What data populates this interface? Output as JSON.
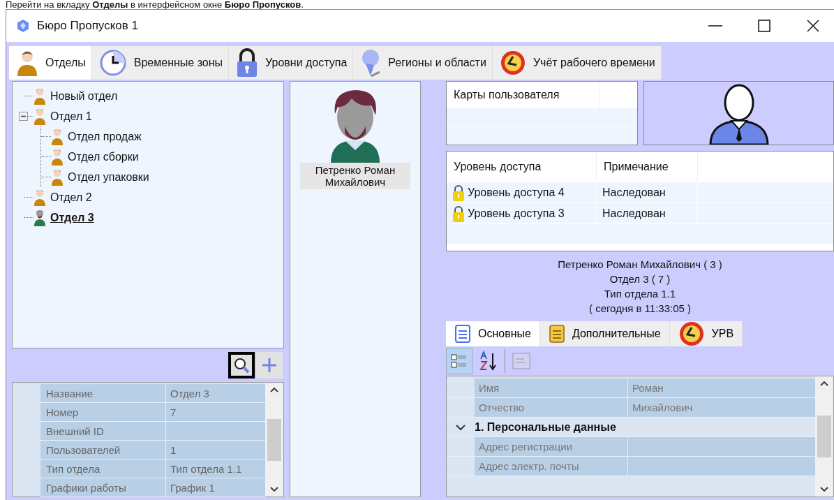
{
  "caption": "Перейти на вкладку **Отделы** в интерфейсном окне **Бюро Пропусков**.",
  "window": {
    "title": "Бюро Пропусков 1"
  },
  "tabs": [
    {
      "label": "Отделы",
      "kind": "person",
      "selected": true
    },
    {
      "label": "Временные зоны",
      "kind": "clock",
      "selected": false
    },
    {
      "label": "Уровни доступа",
      "kind": "lock",
      "selected": false
    },
    {
      "label": "Регионы и области",
      "kind": "pin",
      "selected": false
    },
    {
      "label": "Учёт рабочего времени",
      "kind": "alarm",
      "selected": false
    }
  ],
  "tree": [
    {
      "label": "Новый отдел",
      "selected": false
    },
    {
      "label": "Отдел 1",
      "selected": false,
      "expanded": true,
      "children": [
        {
          "label": "Отдел продаж",
          "selected": false
        },
        {
          "label": "Отдел сборки",
          "selected": false
        },
        {
          "label": "Отдел упаковки",
          "selected": false
        }
      ]
    },
    {
      "label": "Отдел 2",
      "selected": false
    },
    {
      "label": "Отдел 3",
      "selected": true
    }
  ],
  "tree_toolbar": {
    "search_focused": true
  },
  "department_properties": [
    {
      "name": "Название",
      "value": "Отдел 3"
    },
    {
      "name": "Номер",
      "value": "7"
    },
    {
      "name": "Внешний ID"
    },
    {
      "name": "Пользователей",
      "value": "1"
    },
    {
      "name": "Тип отдела",
      "value": "Тип отдела 1.1"
    },
    {
      "name": "Графики работы",
      "value": "График 1"
    }
  ],
  "users": [
    {
      "name": "Петренко Роман Михайлович",
      "selected": true
    }
  ],
  "cards_table": {
    "columns": [
      "Карты пользователя"
    ]
  },
  "access_table": {
    "columns": [
      "Уровень доступа",
      "Примечание"
    ],
    "rows": [
      {
        "level": "Уровень доступа 4",
        "note": "Наследован"
      },
      {
        "level": "Уровень доступа 3",
        "note": "Наследован"
      }
    ]
  },
  "info": [
    "Петренко Роман Михайлович ( 3 )",
    "Отдел 3 ( 7 )",
    "Тип отдела 1.1",
    "( сегодня в 11:33:05 )"
  ],
  "subtabs": [
    {
      "label": "Основные",
      "kind": "list",
      "selected": true
    },
    {
      "label": "Дополнительные",
      "kind": "notes",
      "selected": false
    },
    {
      "label": "УРВ",
      "kind": "alarm",
      "selected": false
    }
  ],
  "grid_toolbar": {
    "categorized_selected": true,
    "alphabetical_selected": false,
    "pages_disabled": true
  },
  "user_properties": [
    {
      "kind": "row",
      "name": "Имя",
      "value": "Роман"
    },
    {
      "kind": "row",
      "name": "Отчество",
      "value": "Михайлович"
    },
    {
      "kind": "category",
      "name": "1. Персональные данные",
      "expanded": true
    },
    {
      "kind": "row",
      "name": "Адрес регистрации"
    },
    {
      "kind": "row",
      "name": "Адрес электр. почты"
    }
  ]
}
